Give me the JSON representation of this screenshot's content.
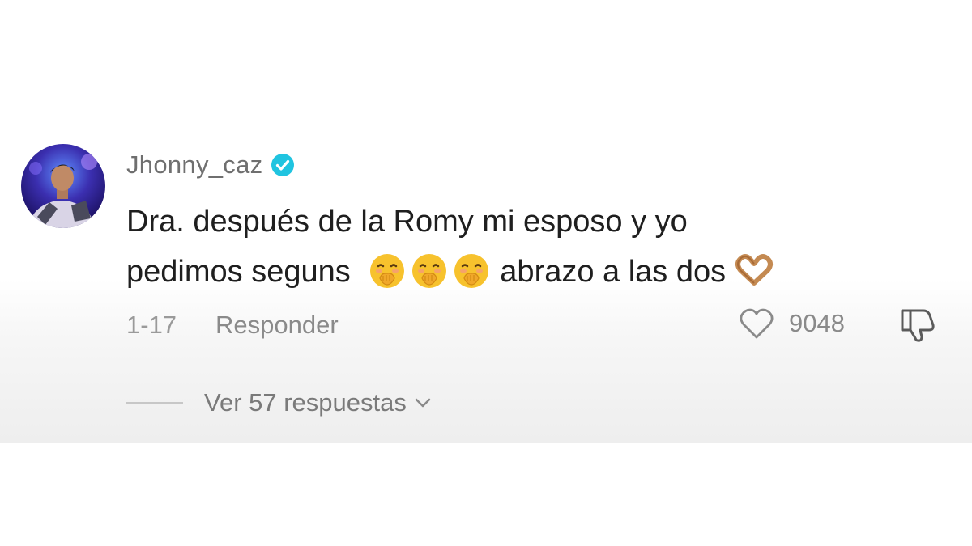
{
  "comment": {
    "username": "Jhonny_caz",
    "verified": true,
    "text_line1": "Dra. después de la Romy mi esposo y yo",
    "text_line2_part1": "pedimos seguns",
    "text_line2_part2": "abrazo a las dos",
    "emojis": [
      "face-with-hand-over-mouth",
      "face-with-hand-over-mouth",
      "face-with-hand-over-mouth",
      "heart-hands"
    ],
    "date": "1-17",
    "reply_label": "Responder",
    "like_count": "9048",
    "view_replies_label": "Ver 57 respuestas"
  },
  "colors": {
    "verified_badge": "#20c4e0",
    "emoji_yellow": "#f7c22d",
    "heart_hands": "#c48a52"
  }
}
